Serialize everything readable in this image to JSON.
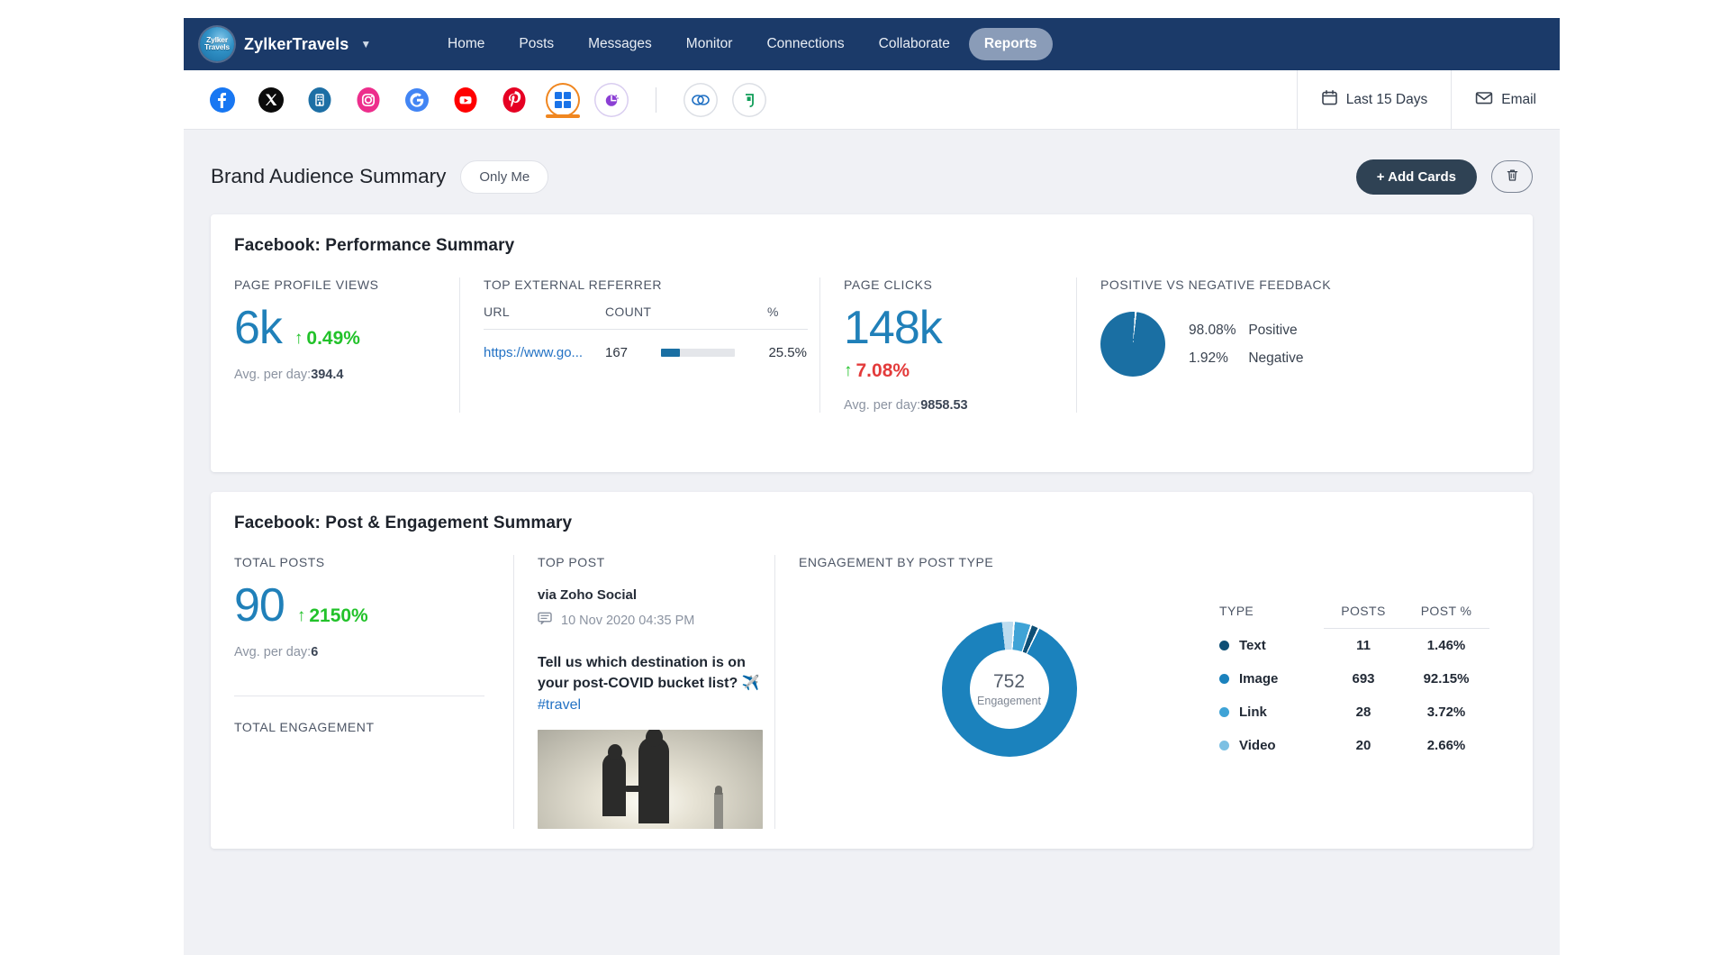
{
  "app": {
    "brand_name": "ZylkerTravels",
    "brand_logo_lines": [
      "Zylker",
      "Travels"
    ],
    "caret_icon": "chevron-down-icon"
  },
  "nav": {
    "items": [
      {
        "label": "Home",
        "active": false
      },
      {
        "label": "Posts",
        "active": false
      },
      {
        "label": "Messages",
        "active": false
      },
      {
        "label": "Monitor",
        "active": false
      },
      {
        "label": "Connections",
        "active": false
      },
      {
        "label": "Collaborate",
        "active": false
      },
      {
        "label": "Reports",
        "active": true
      }
    ]
  },
  "channels": {
    "items": [
      {
        "name": "facebook-channel-icon",
        "active": false
      },
      {
        "name": "x-twitter-channel-icon",
        "active": false
      },
      {
        "name": "linkedin-channel-icon",
        "active": false
      },
      {
        "name": "instagram-channel-icon",
        "active": false
      },
      {
        "name": "google-business-channel-icon",
        "active": false
      },
      {
        "name": "youtube-channel-icon",
        "active": false
      },
      {
        "name": "pinterest-channel-icon",
        "active": false
      },
      {
        "name": "zoho-grid-channel-icon",
        "active": true
      },
      {
        "name": "zoho-analytics-channel-icon",
        "active": false
      },
      {
        "name": "zoho-crm-channel-icon",
        "active": false
      },
      {
        "name": "zoho-desk-channel-icon",
        "active": false
      }
    ],
    "date_range_label": "Last 15 Days",
    "date_range_icon": "calendar-icon",
    "email_label": "Email",
    "email_icon": "envelope-icon"
  },
  "page_header": {
    "title": "Brand Audience Summary",
    "visibility_pill": "Only Me",
    "add_cards_label": "+ Add Cards",
    "delete_icon": "trash-icon"
  },
  "performance_card": {
    "title": "Facebook: Performance Summary",
    "page_profile_views": {
      "label": "PAGE PROFILE VIEWS",
      "value": "6k",
      "delta": "0.49%",
      "delta_direction": "up",
      "delta_color": "#22c22a",
      "avg_prefix": "Avg. per day:",
      "avg_value": "394.4"
    },
    "top_external_referrer": {
      "label": "TOP EXTERNAL REFERRER",
      "columns": [
        "URL",
        "COUNT",
        "%"
      ],
      "rows": [
        {
          "url": "https://www.go...",
          "count": "167",
          "pct": "25.5%",
          "bar_pct": 25.5
        }
      ]
    },
    "page_clicks": {
      "label": "PAGE CLICKS",
      "value": "148k",
      "delta": "7.08%",
      "delta_direction": "up",
      "delta_color": "#e33b3b",
      "avg_prefix": "Avg. per day:",
      "avg_value": "9858.53"
    },
    "feedback": {
      "label": "POSITIVE VS NEGATIVE FEEDBACK",
      "rows": [
        {
          "pct": "98.08%",
          "name": "Positive"
        },
        {
          "pct": "1.92%",
          "name": "Negative"
        }
      ]
    }
  },
  "engagement_card": {
    "title": "Facebook: Post & Engagement Summary",
    "total_posts": {
      "label": "TOTAL POSTS",
      "value": "90",
      "delta": "2150%",
      "delta_direction": "up",
      "delta_color": "#22c22a",
      "avg_prefix": "Avg. per day:",
      "avg_value": "6"
    },
    "total_engagement_label": "TOTAL ENGAGEMENT",
    "top_post": {
      "label": "TOP POST",
      "source": "via Zoho Social",
      "date": "10 Nov 2020 04:35 PM",
      "date_icon": "comment-icon",
      "text": "Tell us which destination is on your post-COVID bucket list? ✈️",
      "hashtag": "#travel",
      "image_alt": "couple-silhouette-sunset-photo"
    },
    "engagement_by_post_type": {
      "label": "ENGAGEMENT BY POST TYPE",
      "columns": [
        "TYPE",
        "POSTS",
        "POST %"
      ]
    }
  },
  "chart_data": [
    {
      "type": "pie",
      "title": "POSITIVE VS NEGATIVE FEEDBACK",
      "categories": [
        "Positive",
        "Negative"
      ],
      "values": [
        98.08,
        1.92
      ],
      "colors": [
        "#1a6fa3",
        "#ffffff"
      ],
      "legend": "right"
    },
    {
      "type": "bar",
      "title": "TOP EXTERNAL REFERRER",
      "categories": [
        "https://www.go..."
      ],
      "values": [
        25.5
      ],
      "ylabel": "%",
      "xlim": [
        0,
        100
      ]
    },
    {
      "type": "pie",
      "title": "ENGAGEMENT BY POST TYPE",
      "center_value": "752",
      "center_label": "Engagement",
      "categories": [
        "Text",
        "Image",
        "Link",
        "Video"
      ],
      "values": [
        11,
        693,
        28,
        20
      ],
      "percents": [
        1.46,
        92.15,
        3.72,
        2.66
      ],
      "colors": [
        "#0e4f76",
        "#1b82bd",
        "#3fa3d6",
        "#bcdcef"
      ],
      "legend": "table",
      "rows": [
        {
          "type": "Text",
          "posts": "11",
          "pct": "1.46%",
          "color": "#0e4f76"
        },
        {
          "type": "Image",
          "posts": "693",
          "pct": "92.15%",
          "color": "#1b82bd"
        },
        {
          "type": "Link",
          "posts": "28",
          "pct": "3.72%",
          "color": "#3fa3d6"
        },
        {
          "type": "Video",
          "posts": "20",
          "pct": "2.66%",
          "color": "#7cc0e3"
        }
      ]
    }
  ]
}
